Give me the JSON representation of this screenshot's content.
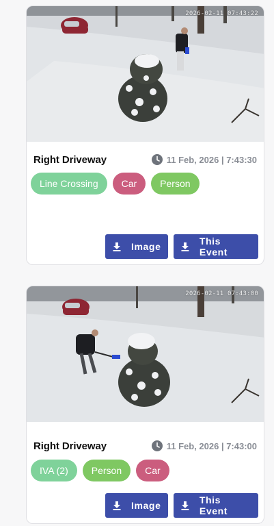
{
  "events": [
    {
      "camera_name": "Right Driveway",
      "overlay_timestamp": "2026-02-11 07:43:22",
      "event_time": "11 Feb, 2026 | 7:43:30",
      "tags": [
        {
          "label": "Line Crossing",
          "color": "#7fd29a"
        },
        {
          "label": "Car",
          "color": "#cb5d7e"
        },
        {
          "label": "Person",
          "color": "#7fc862"
        }
      ],
      "actions": {
        "image_label": "Image",
        "event_label": "This Event"
      }
    },
    {
      "camera_name": "Right Driveway",
      "overlay_timestamp": "2026-02-11 07:43:00",
      "event_time": "11 Feb, 2026 | 7:43:00",
      "tags": [
        {
          "label": "IVA (2)",
          "color": "#7fd29a"
        },
        {
          "label": "Person",
          "color": "#7fc862"
        },
        {
          "label": "Car",
          "color": "#cb5d7e"
        }
      ],
      "actions": {
        "image_label": "Image",
        "event_label": "This Event"
      }
    }
  ],
  "icons": {
    "time": "clock-icon",
    "download": "download-icon"
  },
  "colors": {
    "button": "#3d4ea9",
    "card_bg": "#ffffff",
    "page_bg": "#f7f7f8"
  }
}
